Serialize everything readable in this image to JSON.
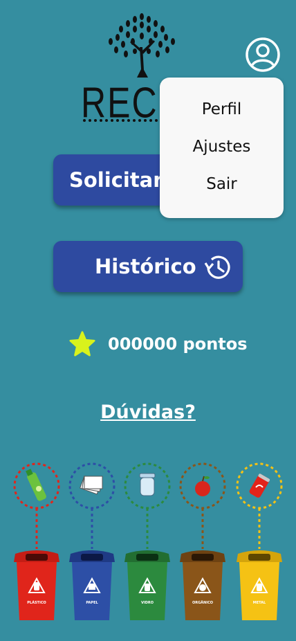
{
  "header": {
    "logo_text": "RECICO",
    "profile_icon": "user-circle-icon"
  },
  "menu": {
    "items": [
      "Perfil",
      "Ajustes",
      "Sair"
    ]
  },
  "actions": {
    "solicitar_label": "Solicitar coleta",
    "historico_label": "Histórico",
    "historico_icon": "history-icon"
  },
  "points": {
    "icon": "star-icon",
    "text": "000000 pontos"
  },
  "help": {
    "link_text": "Dúvidas?"
  },
  "bins": [
    {
      "label": "PLÁSTICO",
      "color": "#e0251b",
      "item_icon": "plastic-bottle-icon"
    },
    {
      "label": "PAPEL",
      "color": "#2d4fa6",
      "item_icon": "paper-stack-icon"
    },
    {
      "label": "VIDRO",
      "color": "#2c8a3e",
      "item_icon": "glass-jar-icon"
    },
    {
      "label": "ORGÂNICO",
      "color": "#8a5519",
      "item_icon": "apple-icon"
    },
    {
      "label": "METAL",
      "color": "#f5c214",
      "item_icon": "soda-can-icon"
    }
  ],
  "colors": {
    "background": "#358ea0",
    "button": "#2e4aa0",
    "star": "#d9f21c"
  }
}
